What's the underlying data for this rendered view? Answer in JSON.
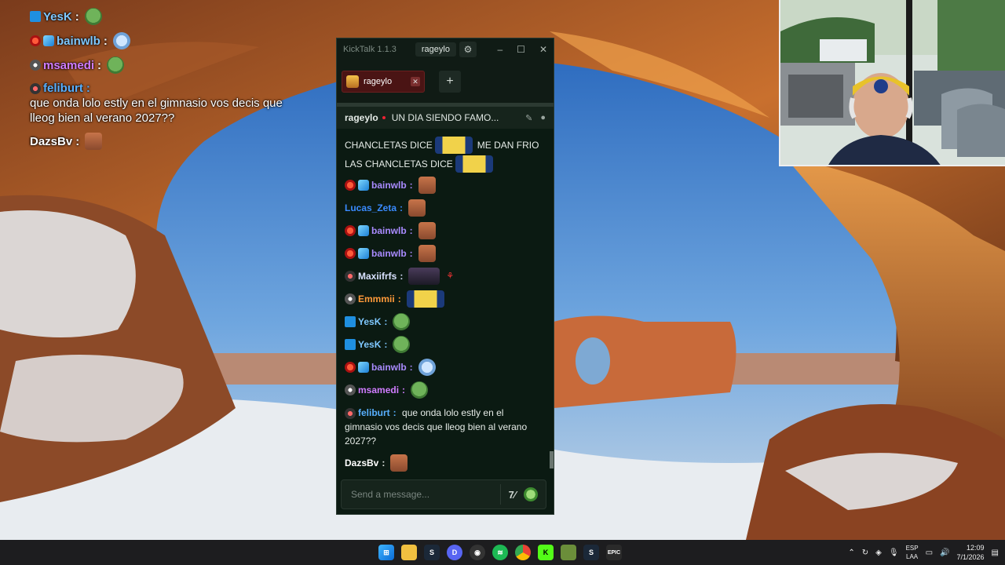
{
  "overlay_chat": [
    {
      "user": "YesK",
      "color": "#7fc8ff",
      "badges": [
        "hammer"
      ],
      "emote": "pepe",
      "text": ""
    },
    {
      "user": "bainwlb",
      "color": "#7fc8ff",
      "badges": [
        "red",
        "blue"
      ],
      "emote": "cry",
      "text": ""
    },
    {
      "user": "msamedi",
      "color": "#d07cff",
      "badges": [
        "sub"
      ],
      "emote": "pepe",
      "text": ""
    },
    {
      "user": "feliburt",
      "color": "#58b0ff",
      "badges": [
        "kick"
      ],
      "emote": "",
      "text": "que onda lolo estly en el gimnasio vos decis que lleog bien al verano 2027??"
    },
    {
      "user": "DazsBv",
      "color": "#ffffff",
      "badges": [],
      "emote": "face",
      "text": ""
    }
  ],
  "window": {
    "app_title": "KickTalk 1.1.3",
    "user": "rageylo",
    "tab_label": "rageylo",
    "add_tab": "+"
  },
  "channel_header": {
    "channel": "rageylo",
    "title": "UN DIA SIENDO FAMO..."
  },
  "messages": [
    {
      "user": "",
      "color": "#fff",
      "badges": [],
      "text": "CHANCLETAS DICE",
      "emote": "minion",
      "text2": "ME DAN FRIO"
    },
    {
      "user": "",
      "color": "#fff",
      "badges": [],
      "text": "LAS CHANCLETAS DICE",
      "emote": "minion",
      "text2": ""
    },
    {
      "user": "bainwlb",
      "color": "#a98bff",
      "badges": [
        "red",
        "blue"
      ],
      "text": "",
      "emote": "face",
      "text2": ""
    },
    {
      "user": "Lucas_Zeta",
      "color": "#3a8bff",
      "badges": [],
      "text": "",
      "emote": "face",
      "text2": ""
    },
    {
      "user": "bainwlb",
      "color": "#a98bff",
      "badges": [
        "red",
        "blue"
      ],
      "text": "",
      "emote": "face",
      "text2": ""
    },
    {
      "user": "bainwlb",
      "color": "#a98bff",
      "badges": [
        "red",
        "blue"
      ],
      "text": "",
      "emote": "face",
      "text2": ""
    },
    {
      "user": "Maxiifrfs",
      "color": "#d9e2ff",
      "badges": [
        "kick"
      ],
      "text": "",
      "emote": "dark",
      "text2": ""
    },
    {
      "user": "Emmmii",
      "color": "#ff9a3a",
      "badges": [
        "sub"
      ],
      "text": "",
      "emote": "minion",
      "text2": ""
    },
    {
      "user": "YesK",
      "color": "#7fc8ff",
      "badges": [
        "hammer"
      ],
      "text": "",
      "emote": "pepe",
      "text2": ""
    },
    {
      "user": "YesK",
      "color": "#7fc8ff",
      "badges": [
        "hammer"
      ],
      "text": "",
      "emote": "pepe",
      "text2": ""
    },
    {
      "user": "bainwlb",
      "color": "#a98bff",
      "badges": [
        "red",
        "blue"
      ],
      "text": "",
      "emote": "cry",
      "text2": ""
    },
    {
      "user": "msamedi",
      "color": "#d07cff",
      "badges": [
        "sub"
      ],
      "text": "",
      "emote": "pepe",
      "text2": ""
    },
    {
      "user": "feliburt",
      "color": "#58b0ff",
      "badges": [
        "kick"
      ],
      "text": "que onda lolo estly en el gimnasio vos decis que lleog bien al verano 2027??",
      "emote": "",
      "text2": ""
    },
    {
      "user": "DazsBv",
      "color": "#fff",
      "badges": [],
      "text": "",
      "emote": "face",
      "text2": ""
    }
  ],
  "input": {
    "placeholder": "Send a message..."
  },
  "taskbar": {
    "apps": [
      "windows-start",
      "file-explorer",
      "steam",
      "discord",
      "obs",
      "spotify",
      "chrome",
      "kick",
      "minecraft",
      "steam-2",
      "epic-games"
    ],
    "language_top": "ESP",
    "language_bottom": "LAA",
    "time": "12:09",
    "date": "7/1/2026"
  }
}
